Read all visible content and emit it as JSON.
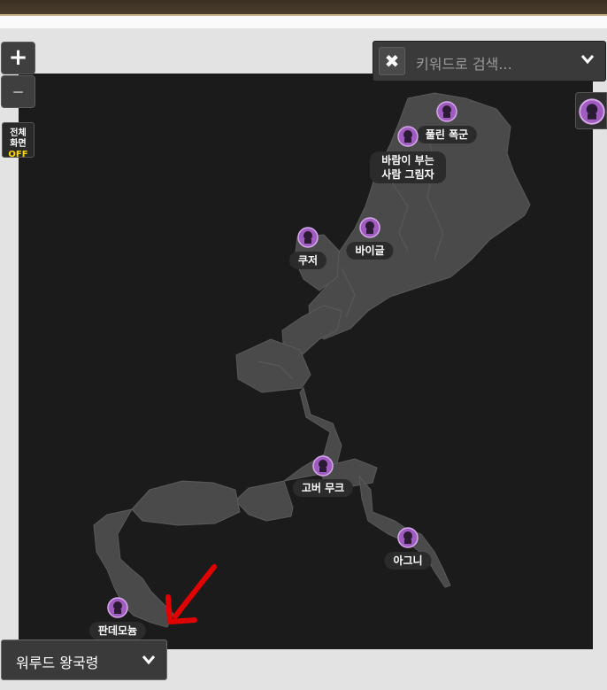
{
  "controls": {
    "zoom_in": "+",
    "zoom_out": "–",
    "fullscreen_line1": "전체",
    "fullscreen_line2": "화면",
    "fullscreen_state": "OFF",
    "search_clear": "✖",
    "search_placeholder": "키워드로 검색..."
  },
  "region": {
    "selected": "워루드 왕국령"
  },
  "markers": [
    {
      "name": "풀린 폭군",
      "icon": "boss-portrait-icon"
    },
    {
      "name": "바람이 부는 사람 그림자",
      "icon": "boss-portrait-icon"
    },
    {
      "name": "바이글",
      "icon": "boss-portrait-icon"
    },
    {
      "name": "쿠저",
      "icon": "boss-portrait-icon"
    },
    {
      "name": "고버 무크",
      "icon": "boss-portrait-icon"
    },
    {
      "name": "아그니",
      "icon": "boss-portrait-icon"
    },
    {
      "name": "판데모늄",
      "icon": "boss-portrait-icon"
    }
  ],
  "colors": {
    "map_background": "#1b1b1b",
    "land": "#4a4a4a",
    "marker": "#a05cc0",
    "arrow": "#e00000",
    "fullscreen_off": "#ffd800"
  }
}
